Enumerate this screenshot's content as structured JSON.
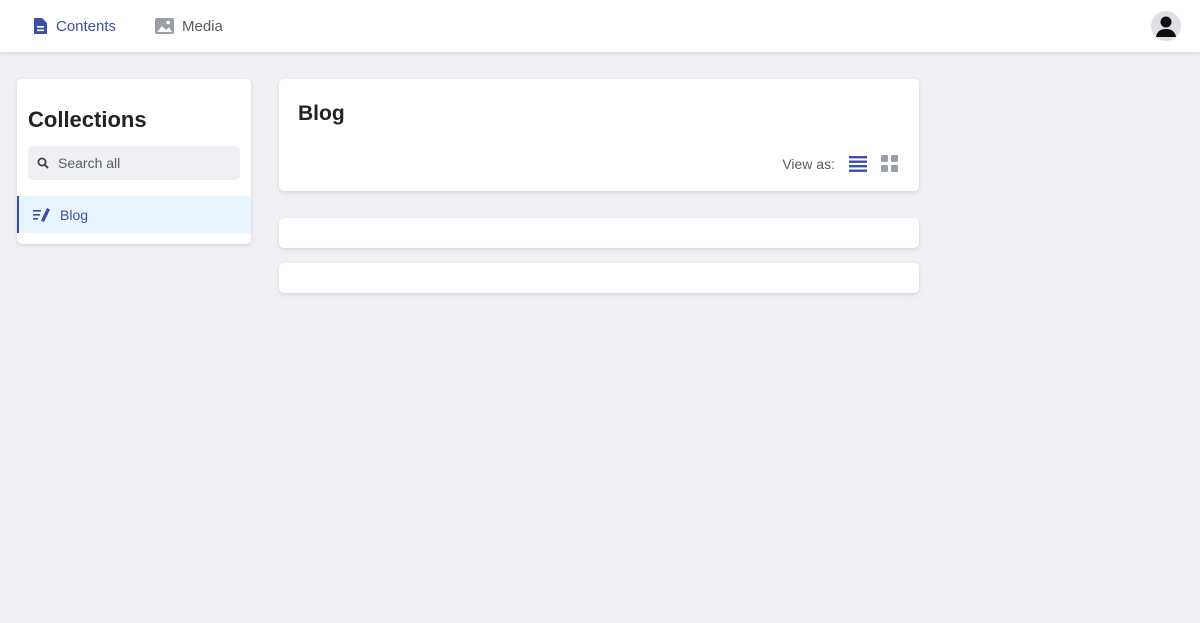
{
  "nav": {
    "contents": "Contents",
    "media": "Media"
  },
  "sidebar": {
    "title": "Collections",
    "search_placeholder": "Search all",
    "collections": [
      {
        "label": "Blog"
      }
    ]
  },
  "main": {
    "title": "Blog",
    "view_as": "View as:"
  },
  "colors": {
    "accent": "#3a4fa8",
    "background": "#eff0f4",
    "active_bg": "#e8f5fe"
  }
}
